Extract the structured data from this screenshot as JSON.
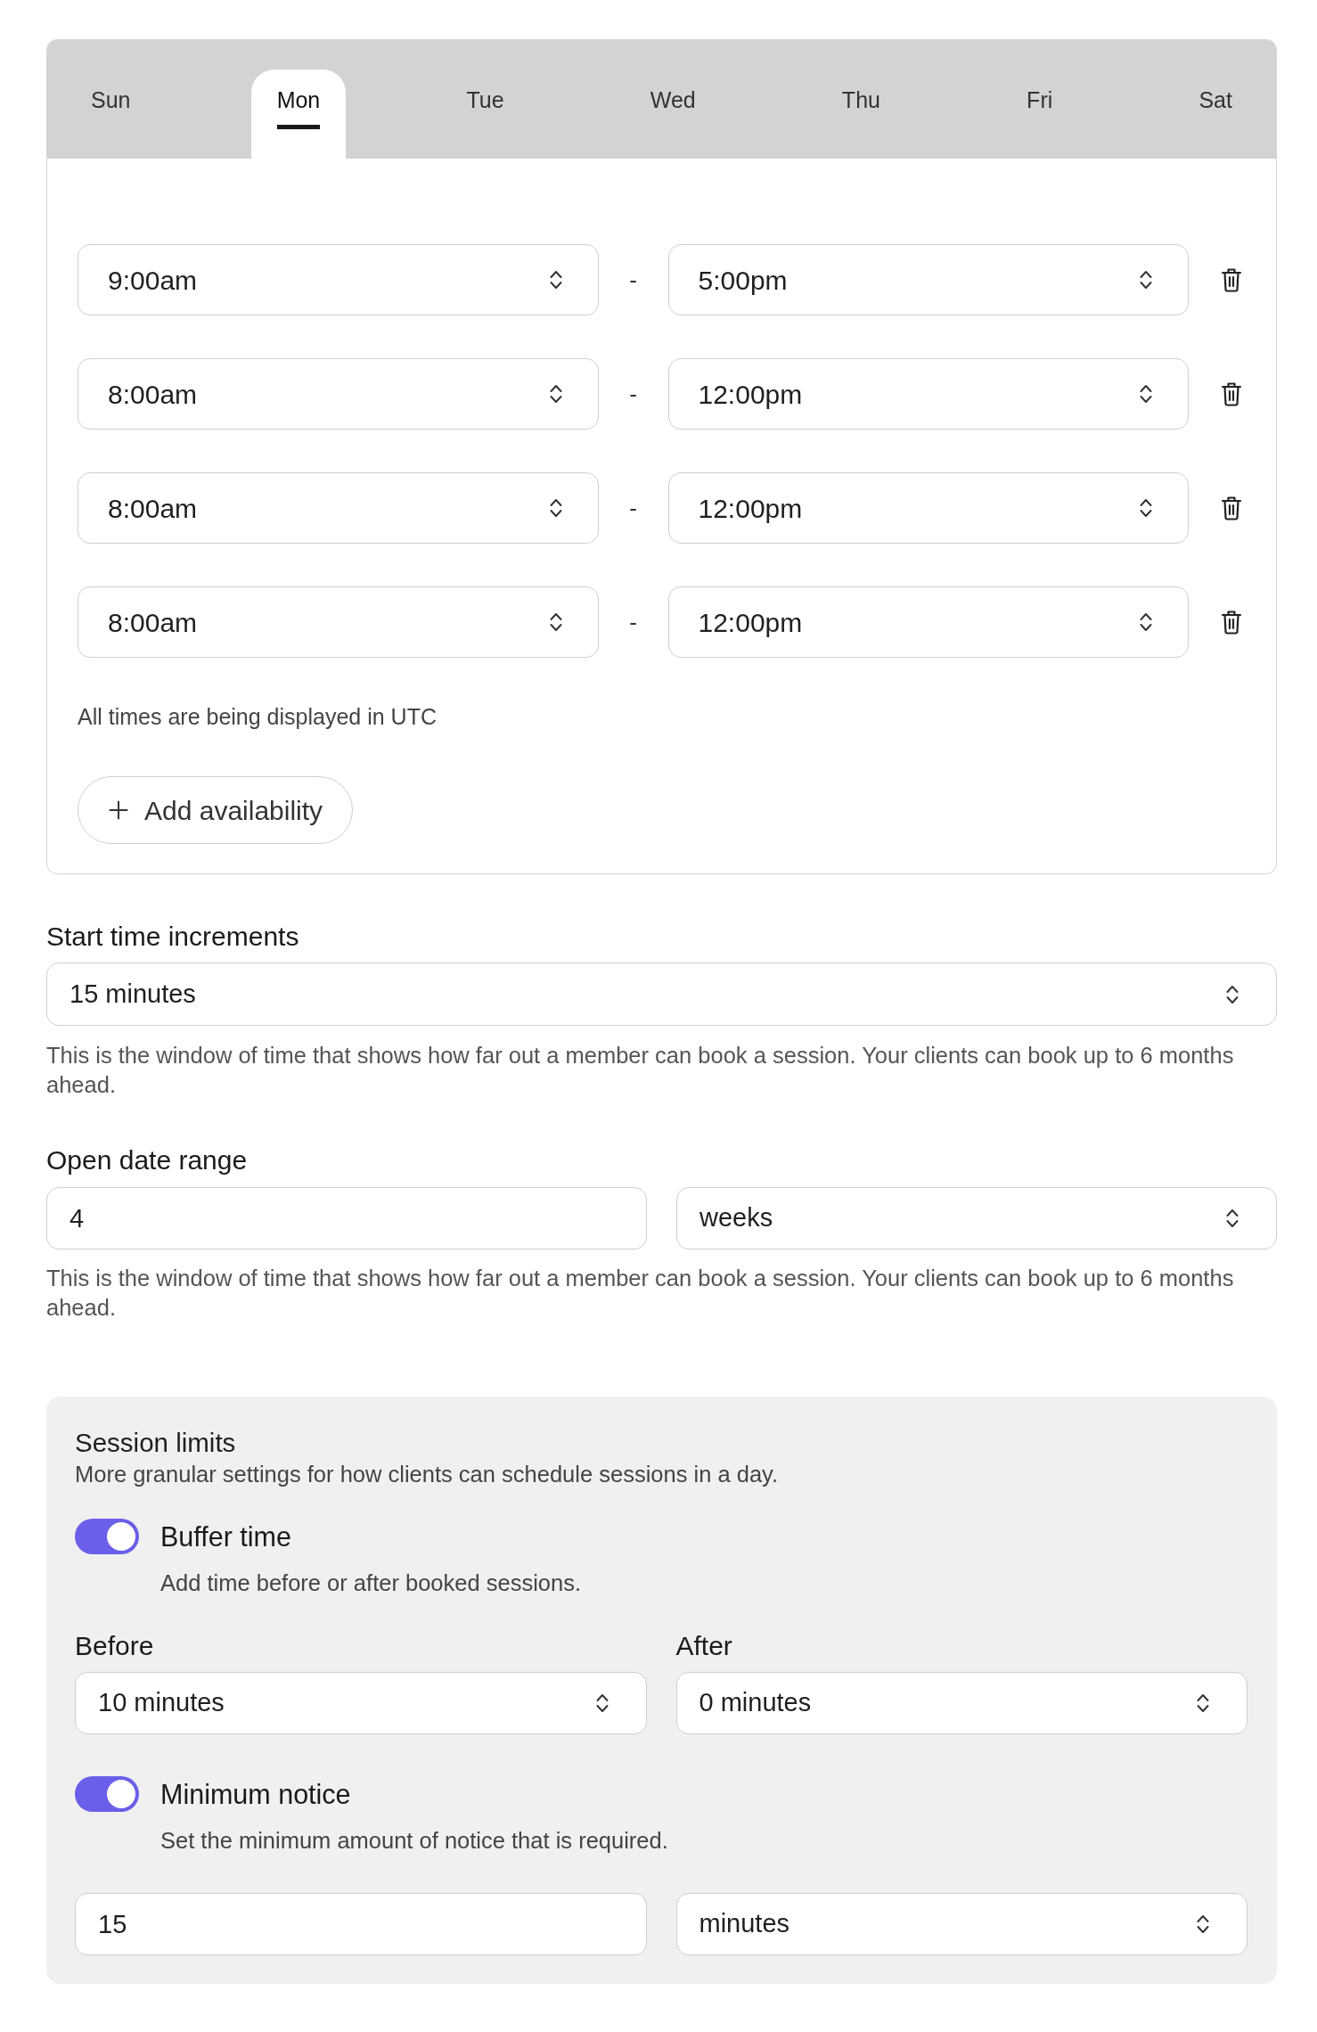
{
  "day_tabs": [
    {
      "label": "Sun",
      "selected": false
    },
    {
      "label": "Mon",
      "selected": true
    },
    {
      "label": "Tue",
      "selected": false
    },
    {
      "label": "Wed",
      "selected": false
    },
    {
      "label": "Thu",
      "selected": false
    },
    {
      "label": "Fri",
      "selected": false
    },
    {
      "label": "Sat",
      "selected": false
    }
  ],
  "time_slots": [
    {
      "start": "9:00am",
      "separator": "-",
      "end": "5:00pm"
    },
    {
      "start": "8:00am",
      "separator": "-",
      "end": "12:00pm"
    },
    {
      "start": "8:00am",
      "separator": "-",
      "end": "12:00pm"
    },
    {
      "start": "8:00am",
      "separator": "-",
      "end": "12:00pm"
    }
  ],
  "timezone_note": "All times are being displayed in UTC",
  "add_button": {
    "label": "Add availability"
  },
  "start_time_increments": {
    "label": "Start time increments",
    "value": "15 minutes",
    "help": "This is the window of time that shows how far out a member can book a session. Your clients can book up to 6 months ahead."
  },
  "open_date_range": {
    "label": "Open date range",
    "amount": "4",
    "unit": "weeks",
    "help": "This is the window of time that shows how far out a member can book a session. Your clients can book up to 6 months ahead."
  },
  "session_limits": {
    "title": "Session limits",
    "subtitle": "More granular settings for how clients can schedule sessions in a day.",
    "settings": [
      {
        "kind": "buffer",
        "label": "Buffer time",
        "on": true,
        "description": "Add time before or after booked sessions.",
        "fields": [
          {
            "label": "Before",
            "value": "10 minutes"
          },
          {
            "label": "After",
            "value": "0 minutes"
          }
        ]
      },
      {
        "kind": "notice",
        "label": "Minimum notice",
        "on": true,
        "description": "Set the minimum amount of notice that is required.",
        "amount": "15",
        "unit": "minutes"
      }
    ]
  }
}
